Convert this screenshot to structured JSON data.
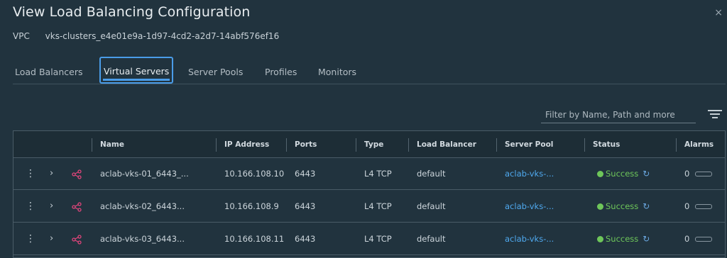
{
  "dialog": {
    "title": "View Load Balancing Configuration",
    "close_icon": "×",
    "vpc_label": "VPC",
    "vpc_value": "vks-clusters_e4e01e9a-1d97-4cd2-a2d7-14abf576ef16"
  },
  "tabs": [
    {
      "label": "Load Balancers",
      "active": false
    },
    {
      "label": "Virtual Servers",
      "active": true
    },
    {
      "label": "Server Pools",
      "active": false
    },
    {
      "label": "Profiles",
      "active": false
    },
    {
      "label": "Monitors",
      "active": false
    }
  ],
  "filter": {
    "placeholder": "Filter by Name, Path and more",
    "icon": "filter-icon"
  },
  "table": {
    "headers": {
      "name": "Name",
      "ip": "IP Address",
      "ports": "Ports",
      "type": "Type",
      "lb": "Load Balancer",
      "pool": "Server Pool",
      "status": "Status",
      "alarms": "Alarms"
    },
    "rows": [
      {
        "name": "aclab-vks-01_6443_...",
        "ip": "10.166.108.10",
        "ports": "6443",
        "type": "L4 TCP",
        "lb": "default",
        "pool": "aclab-vks-...",
        "status": "Success",
        "alarms": "0"
      },
      {
        "name": "aclab-vks-02_6443...",
        "ip": "10.166.108.9",
        "ports": "6443",
        "type": "L4 TCP",
        "lb": "default",
        "pool": "aclab-vks-...",
        "status": "Success",
        "alarms": "0"
      },
      {
        "name": "aclab-vks-03_6443...",
        "ip": "10.166.108.11",
        "ports": "6443",
        "type": "L4 TCP",
        "lb": "default",
        "pool": "aclab-vks-...",
        "status": "Success",
        "alarms": "0"
      }
    ]
  },
  "colors": {
    "background": "#21333e",
    "accent": "#4a9ce8",
    "success": "#6ec65a",
    "link": "#4fa9ef",
    "virtual_server_icon": "#e0457b"
  }
}
